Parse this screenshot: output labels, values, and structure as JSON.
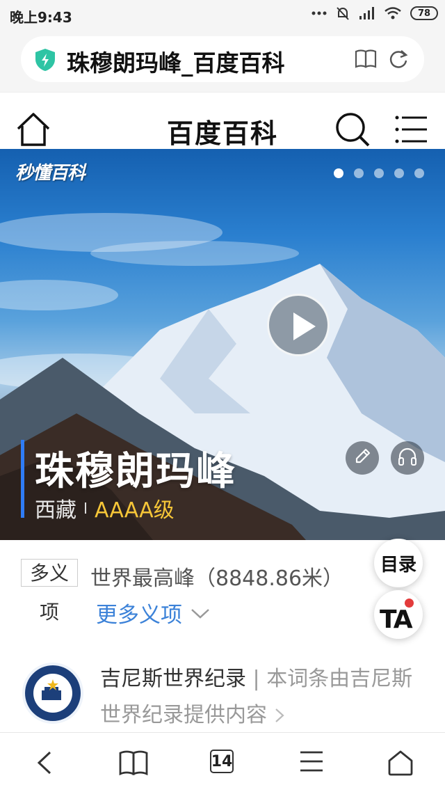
{
  "status_bar": {
    "time": "晚上9:43",
    "battery": "78"
  },
  "address_bar": {
    "title": "珠穆朗玛峰_百度百科",
    "icons": [
      "shield-icon",
      "book-icon",
      "reload-icon"
    ]
  },
  "header": {
    "site_title": "百度百科",
    "icons": [
      "home-icon",
      "search-icon",
      "menu-icon"
    ]
  },
  "hero": {
    "watermark": "秒懂百科",
    "title": "珠穆朗玛峰",
    "location": "西藏",
    "level": "AAAA级",
    "carousel_total": 5,
    "carousel_active": 1
  },
  "polysemy": {
    "label_line1": "多义",
    "label_line2": "项",
    "description": "世界最高峰（8848.86米）",
    "more_link": "更多义项"
  },
  "floating": {
    "toc": "目录",
    "ta": "TA"
  },
  "guinness": {
    "title": "吉尼斯世界纪录",
    "separator": " | ",
    "description": "本词条由吉尼斯世界纪录提供内容"
  },
  "bottom_nav": {
    "tab_count": "14",
    "icons": [
      "back-icon",
      "bookmark-icon",
      "tabs-icon",
      "menu-icon",
      "home-icon"
    ]
  },
  "colors": {
    "accent_blue": "#3c82d8",
    "level_yellow": "#f6c638",
    "title_bar_blue": "#2f7cf6",
    "ta_red": "#e33b3b"
  }
}
